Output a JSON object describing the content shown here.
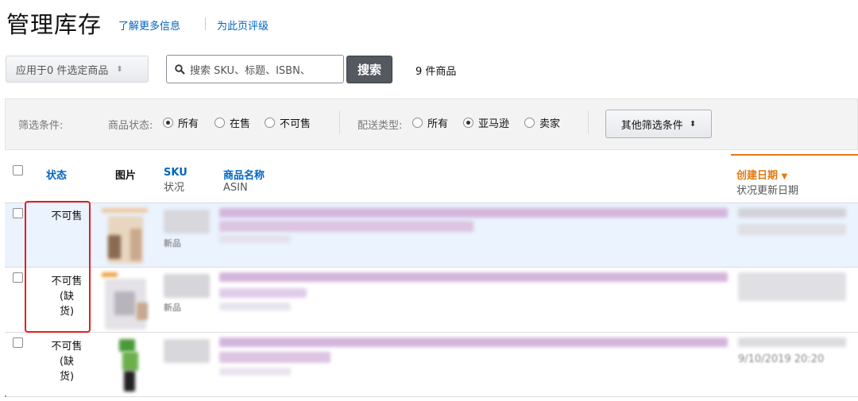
{
  "header": {
    "title": "管理库存",
    "learn_more": "了解更多信息",
    "rate_page": "为此页评级"
  },
  "toolbar": {
    "bulk_action": "应用于0 件选定商品",
    "search_placeholder": "搜索 SKU、标题、ISBN、",
    "search_button": "搜索",
    "item_count": "9 件商品"
  },
  "filters": {
    "label": "筛选条件:",
    "listing_status_label": "商品状态:",
    "listing_status_options": [
      {
        "label": "所有",
        "checked": true
      },
      {
        "label": "在售",
        "checked": false
      },
      {
        "label": "不可售",
        "checked": false
      }
    ],
    "fulfillment_label": "配送类型:",
    "fulfillment_options": [
      {
        "label": "所有",
        "checked": false
      },
      {
        "label": "亚马逊",
        "checked": true
      },
      {
        "label": "卖家",
        "checked": false
      }
    ],
    "more_filters": "其他筛选条件"
  },
  "table": {
    "columns": {
      "status": "状态",
      "image": "图片",
      "sku": "SKU",
      "condition": "状况",
      "product_name": "商品名称",
      "asin": "ASIN",
      "date_created": "创建日期",
      "status_updated": "状况更新日期"
    },
    "rows": [
      {
        "status_line1": "不可售",
        "status_line2": "",
        "status_line3": "",
        "condition": "新品"
      },
      {
        "status_line1": "不可售",
        "status_line2": "(缺",
        "status_line3": "货)",
        "condition": "新品"
      },
      {
        "status_line1": "不可售",
        "status_line2": "(缺",
        "status_line3": "货)",
        "date_partial": "9/10/2019 20:20"
      }
    ]
  },
  "colors": {
    "link_blue": "#0066c0",
    "sort_orange": "#e47911",
    "highlight_red": "#e02020",
    "selected_row": "#eaf3fe"
  }
}
